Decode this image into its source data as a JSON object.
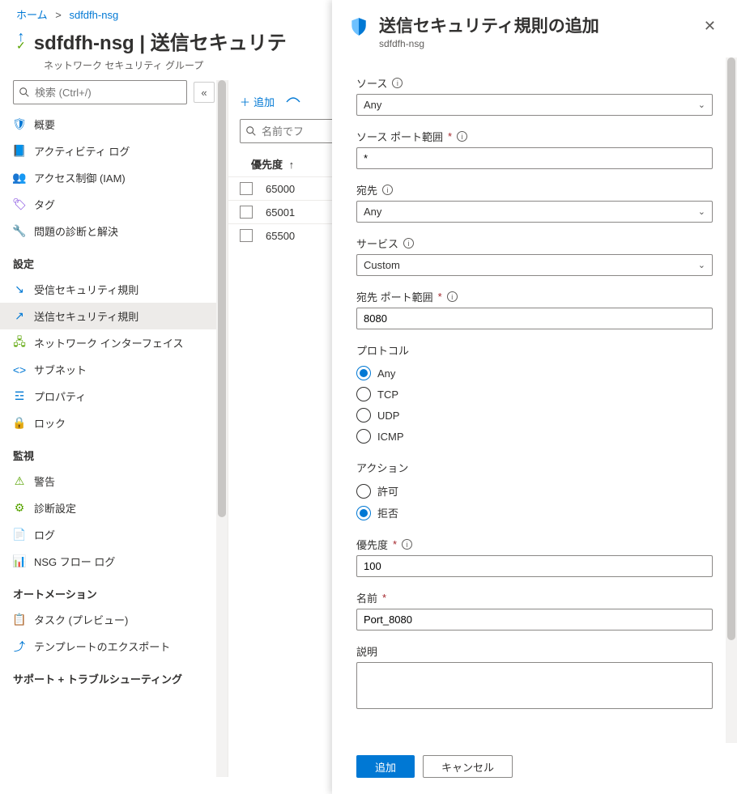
{
  "breadcrumb": {
    "home": "ホーム",
    "current": "sdfdfh-nsg"
  },
  "page": {
    "title": "sdfdfh-nsg | 送信セキュリテ",
    "subtitle": "ネットワーク セキュリティ グループ",
    "search_placeholder": "検索 (Ctrl+/)"
  },
  "nav": {
    "items_top": [
      {
        "icon": "shield-icon",
        "label": "概要",
        "color": "#0078d4"
      },
      {
        "icon": "activity-icon",
        "label": "アクティビティ ログ",
        "color": "#0078d4"
      },
      {
        "icon": "iam-icon",
        "label": "アクセス制御 (IAM)",
        "color": "#773adc"
      },
      {
        "icon": "tag-icon",
        "label": "タグ",
        "color": "#773adc"
      },
      {
        "icon": "diagnose-icon",
        "label": "問題の診断と解決",
        "color": "#605e5c"
      }
    ],
    "group_settings": "設定",
    "items_settings": [
      {
        "icon": "inbound-icon",
        "label": "受信セキュリティ規則",
        "color": "#0078d4"
      },
      {
        "icon": "outbound-icon",
        "label": "送信セキュリティ規則",
        "color": "#0078d4",
        "selected": true
      },
      {
        "icon": "nic-icon",
        "label": "ネットワーク インターフェイス",
        "color": "#57a300"
      },
      {
        "icon": "subnet-icon",
        "label": "サブネット",
        "color": "#0078d4"
      },
      {
        "icon": "properties-icon",
        "label": "プロパティ",
        "color": "#0078d4"
      },
      {
        "icon": "lock-icon",
        "label": "ロック",
        "color": "#0078d4"
      }
    ],
    "group_monitoring": "監視",
    "items_monitoring": [
      {
        "icon": "alert-icon",
        "label": "警告",
        "color": "#57a300"
      },
      {
        "icon": "diag-settings-icon",
        "label": "診断設定",
        "color": "#57a300"
      },
      {
        "icon": "log-icon",
        "label": "ログ",
        "color": "#0078d4"
      },
      {
        "icon": "flow-log-icon",
        "label": "NSG フロー ログ",
        "color": "#57a300"
      }
    ],
    "group_automation": "オートメーション",
    "items_automation": [
      {
        "icon": "tasks-icon",
        "label": "タスク (プレビュー)",
        "color": "#0078d4"
      },
      {
        "icon": "export-icon",
        "label": "テンプレートのエクスポート",
        "color": "#0078d4"
      }
    ],
    "group_support": "サポート + トラブルシューティング"
  },
  "toolbar": {
    "add": "追加"
  },
  "table": {
    "filter_placeholder": "名前でフ",
    "col_priority": "優先度",
    "rows": [
      {
        "priority": "65000"
      },
      {
        "priority": "65001"
      },
      {
        "priority": "65500"
      }
    ]
  },
  "panel": {
    "title": "送信セキュリティ規則の追加",
    "subtitle": "sdfdfh-nsg",
    "labels": {
      "source": "ソース",
      "source_port": "ソース ポート範囲",
      "destination": "宛先",
      "service": "サービス",
      "dest_port": "宛先 ポート範囲",
      "protocol": "プロトコル",
      "action": "アクション",
      "priority": "優先度",
      "name": "名前",
      "description": "説明"
    },
    "values": {
      "source": "Any",
      "source_port": "*",
      "destination": "Any",
      "service": "Custom",
      "dest_port": "8080",
      "priority": "100",
      "name": "Port_8080"
    },
    "protocol_options": [
      "Any",
      "TCP",
      "UDP",
      "ICMP"
    ],
    "protocol_selected": "Any",
    "action_options": {
      "allow": "許可",
      "deny": "拒否"
    },
    "action_selected": "deny",
    "buttons": {
      "add": "追加",
      "cancel": "キャンセル"
    }
  }
}
